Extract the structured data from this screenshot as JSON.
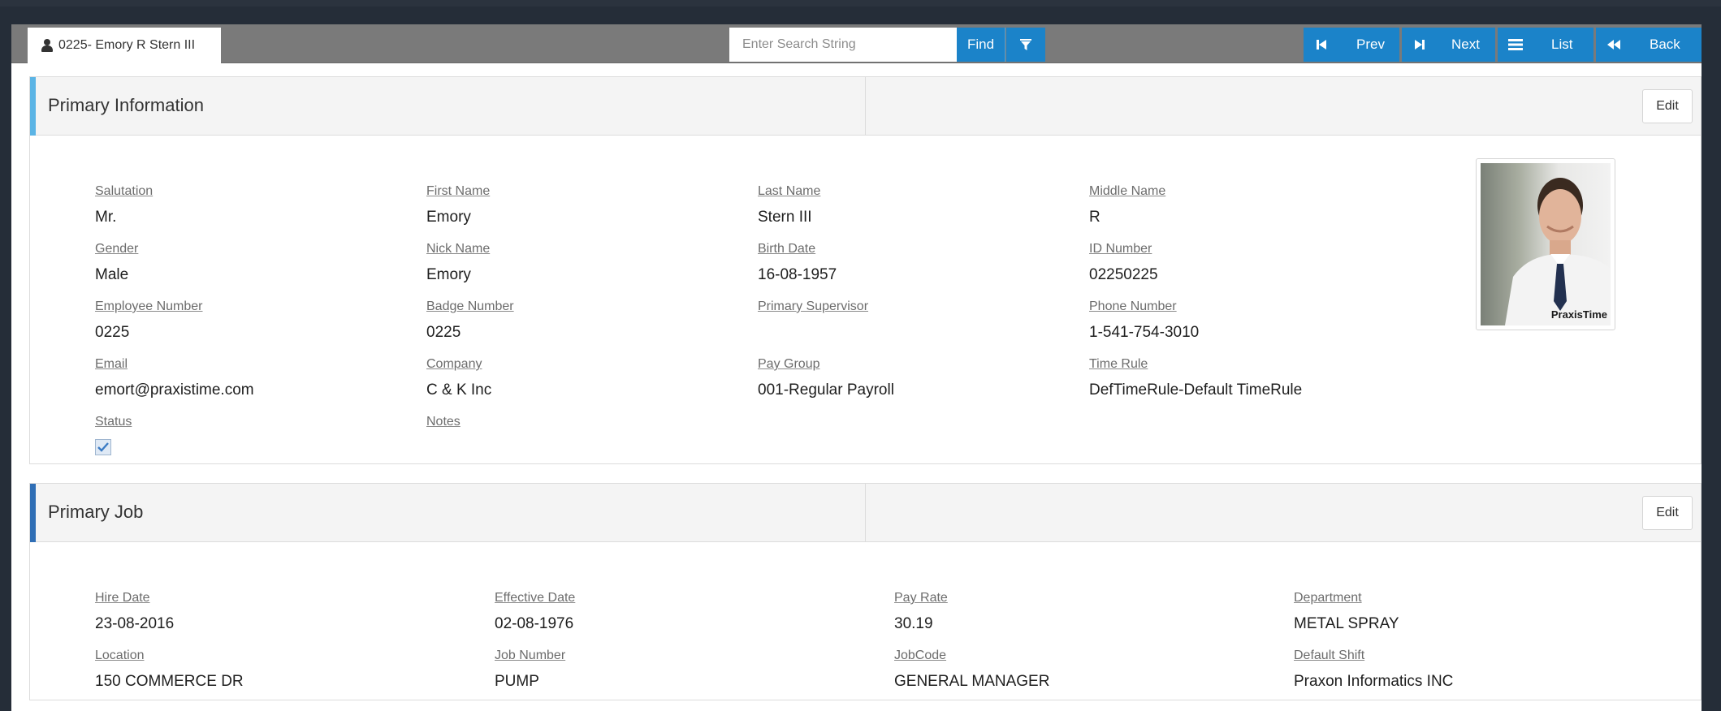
{
  "toolbar": {
    "record_label": "0225- Emory R Stern III",
    "search_placeholder": "Enter Search String",
    "find_label": "Find",
    "prev_label": "Prev",
    "next_label": "Next",
    "list_label": "List",
    "back_label": "Back",
    "accent_color": "#1b83c9"
  },
  "primary_info": {
    "title": "Primary Information",
    "edit_label": "Edit",
    "accent_color": "#5bb4e5",
    "fields": {
      "salutation": {
        "label": "Salutation",
        "value": "Mr."
      },
      "first_name": {
        "label": "First Name",
        "value": "Emory"
      },
      "last_name": {
        "label": "Last Name",
        "value": "Stern III"
      },
      "middle_name": {
        "label": "Middle Name",
        "value": "R"
      },
      "gender": {
        "label": "Gender",
        "value": "Male"
      },
      "nick_name": {
        "label": "Nick Name",
        "value": "Emory"
      },
      "birth_date": {
        "label": "Birth Date",
        "value": "16-08-1957"
      },
      "id_number": {
        "label": "ID Number",
        "value": "02250225"
      },
      "employee_number": {
        "label": "Employee Number",
        "value": "0225"
      },
      "badge_number": {
        "label": "Badge Number",
        "value": "0225"
      },
      "primary_supervisor": {
        "label": "Primary Supervisor",
        "value": ""
      },
      "phone_number": {
        "label": "Phone Number",
        "value": "1-541-754-3010"
      },
      "email": {
        "label": "Email",
        "value": "emort@praxistime.com"
      },
      "company": {
        "label": "Company",
        "value": "C & K Inc"
      },
      "pay_group": {
        "label": "Pay Group",
        "value": "001-Regular Payroll"
      },
      "time_rule": {
        "label": "Time Rule",
        "value": "DefTimeRule-Default TimeRule"
      },
      "status": {
        "label": "Status",
        "checked": true
      },
      "notes": {
        "label": "Notes",
        "value": ""
      }
    },
    "photo_watermark": "PraxisTime"
  },
  "primary_job": {
    "title": "Primary Job",
    "edit_label": "Edit",
    "accent_color": "#2f6eb5",
    "fields": {
      "hire_date": {
        "label": "Hire Date",
        "value": "23-08-2016"
      },
      "effective_date": {
        "label": "Effective Date",
        "value": "02-08-1976"
      },
      "pay_rate": {
        "label": "Pay Rate",
        "value": "30.19"
      },
      "department": {
        "label": "Department",
        "value": "METAL SPRAY"
      },
      "location": {
        "label": "Location",
        "value": "150 COMMERCE DR"
      },
      "job_number": {
        "label": "Job Number",
        "value": "PUMP"
      },
      "jobcode": {
        "label": "JobCode",
        "value": "GENERAL MANAGER"
      },
      "default_shift": {
        "label": "Default Shift",
        "value": "Praxon Informatics INC"
      }
    }
  }
}
